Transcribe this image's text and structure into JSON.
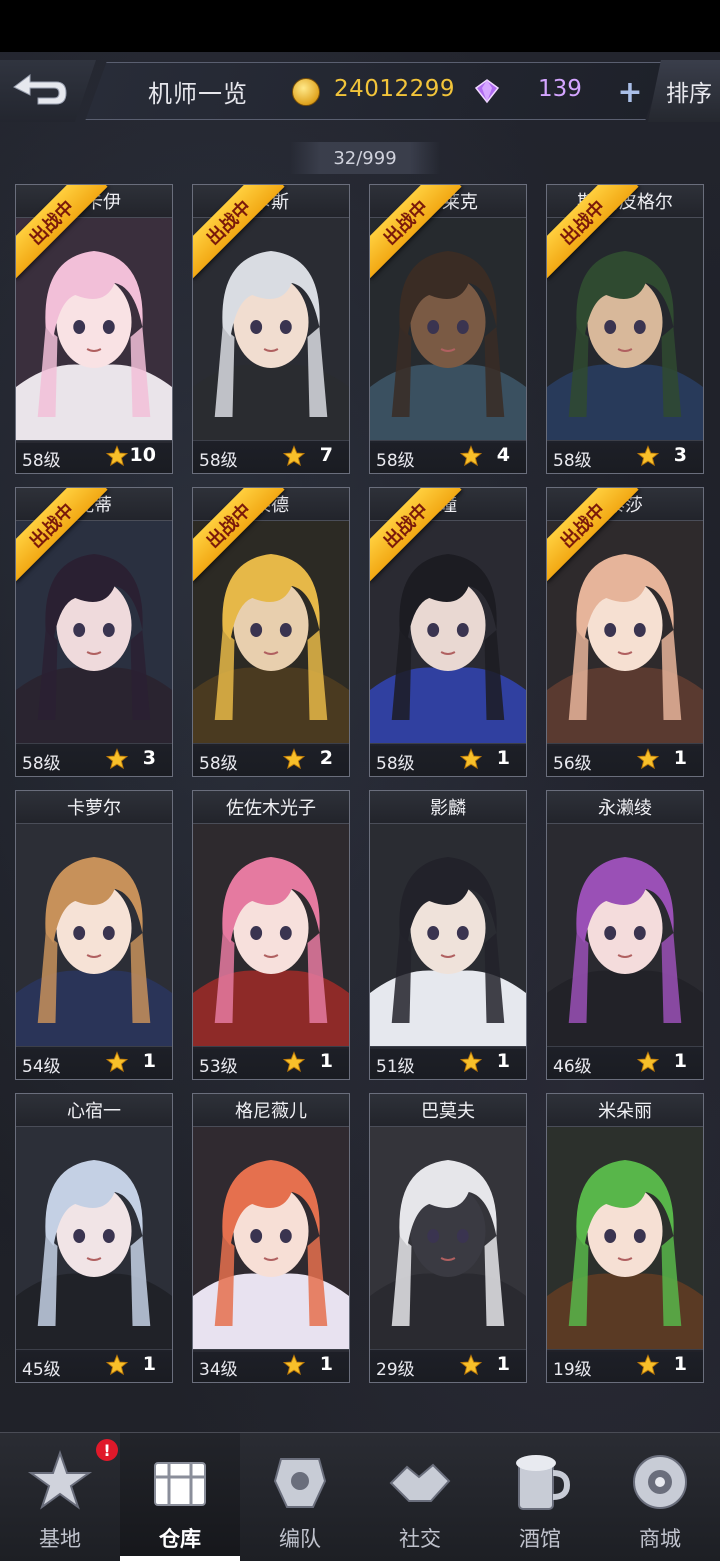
{
  "header": {
    "title": "机师一览",
    "coins": "24012299",
    "gems": "139",
    "plus": "+",
    "sort_label": "排序"
  },
  "count": "32/999",
  "battle_tag": "出战中",
  "pilots": [
    {
      "name": "格卡伊",
      "level": "58级",
      "stars": "10",
      "in_battle": true,
      "hair": "#f2bfd8",
      "skin": "#f9e2e4",
      "outfit": "#eae4ea",
      "bg": "#3a2f3d"
    },
    {
      "name": "卡斯",
      "level": "58级",
      "stars": "7",
      "in_battle": true,
      "hair": "#d9dce2",
      "skin": "#f1ddd0",
      "outfit": "#2a2c30",
      "bg": "#2a2c33"
    },
    {
      "name": "·布莱克",
      "level": "58级",
      "stars": "4",
      "in_battle": true,
      "hair": "#3a2c24",
      "skin": "#7a5a44",
      "outfit": "#3a5060",
      "bg": "#262a2e"
    },
    {
      "name": "斯·斯皮格尔",
      "level": "58级",
      "stars": "3",
      "in_battle": true,
      "hair": "#2f4a30",
      "skin": "#d8b89a",
      "outfit": "#283a5a",
      "bg": "#24272d"
    },
    {
      "name": "妮蒂",
      "level": "58级",
      "stars": "3",
      "in_battle": true,
      "hair": "#2a2032",
      "skin": "#efdadc",
      "outfit": "#2a2430",
      "bg": "#2a3040"
    },
    {
      "name": "莱德",
      "level": "58级",
      "stars": "2",
      "in_battle": true,
      "hair": "#e6b848",
      "skin": "#e8cfae",
      "outfit": "#4a3a20",
      "bg": "#2c2a24"
    },
    {
      "name": "瞳",
      "level": "58级",
      "stars": "1",
      "in_battle": true,
      "hair": "#1c1c22",
      "skin": "#e9d8d2",
      "outfit": "#3040a0",
      "bg": "#2a2a32"
    },
    {
      "name": "泰莎",
      "level": "56级",
      "stars": "1",
      "in_battle": true,
      "hair": "#e6b49a",
      "skin": "#f6e0d2",
      "outfit": "#5a3a30",
      "bg": "#2e2a2c"
    },
    {
      "name": "卡萝尔",
      "level": "54级",
      "stars": "1",
      "in_battle": false,
      "hair": "#c7915a",
      "skin": "#f6e2d6",
      "outfit": "#2a3458",
      "bg": "#2c2e36"
    },
    {
      "name": "佐佐木光子",
      "level": "53级",
      "stars": "1",
      "in_battle": false,
      "hair": "#e57aa0",
      "skin": "#f7e0dc",
      "outfit": "#8e2a28",
      "bg": "#2e2a2e"
    },
    {
      "name": "影麟",
      "level": "51级",
      "stars": "1",
      "in_battle": false,
      "hair": "#22222a",
      "skin": "#efe2da",
      "outfit": "#e6e8ee",
      "bg": "#2a2c32"
    },
    {
      "name": "永濑绫",
      "level": "46级",
      "stars": "1",
      "in_battle": false,
      "hair": "#9a50b6",
      "skin": "#f4dcdc",
      "outfit": "#222228",
      "bg": "#2a2a30"
    },
    {
      "name": "心宿一",
      "level": "45级",
      "stars": "1",
      "in_battle": false,
      "hair": "#c4d0e4",
      "skin": "#f1e4e6",
      "outfit": "#202228",
      "bg": "#2c2f38"
    },
    {
      "name": "格尼薇儿",
      "level": "34级",
      "stars": "1",
      "in_battle": false,
      "hair": "#e5704e",
      "skin": "#f7dfd6",
      "outfit": "#e8e2f0",
      "bg": "#302a30"
    },
    {
      "name": "巴莫夫",
      "level": "29级",
      "stars": "1",
      "in_battle": false,
      "hair": "#e6e6ea",
      "skin": "#3a3a42",
      "outfit": "#2a2a30",
      "bg": "#34343a"
    },
    {
      "name": "米朵丽",
      "level": "19级",
      "stars": "1",
      "in_battle": false,
      "hair": "#58b64a",
      "skin": "#f6e0d4",
      "outfit": "#5a3a24",
      "bg": "#2c302c"
    }
  ],
  "nav": [
    {
      "label": "基地",
      "icon": "base-icon",
      "alert": "!"
    },
    {
      "label": "仓库",
      "icon": "warehouse-icon",
      "active": true
    },
    {
      "label": "编队",
      "icon": "formation-icon"
    },
    {
      "label": "社交",
      "icon": "social-icon"
    },
    {
      "label": "酒馆",
      "icon": "tavern-icon"
    },
    {
      "label": "商城",
      "icon": "shop-icon"
    }
  ]
}
